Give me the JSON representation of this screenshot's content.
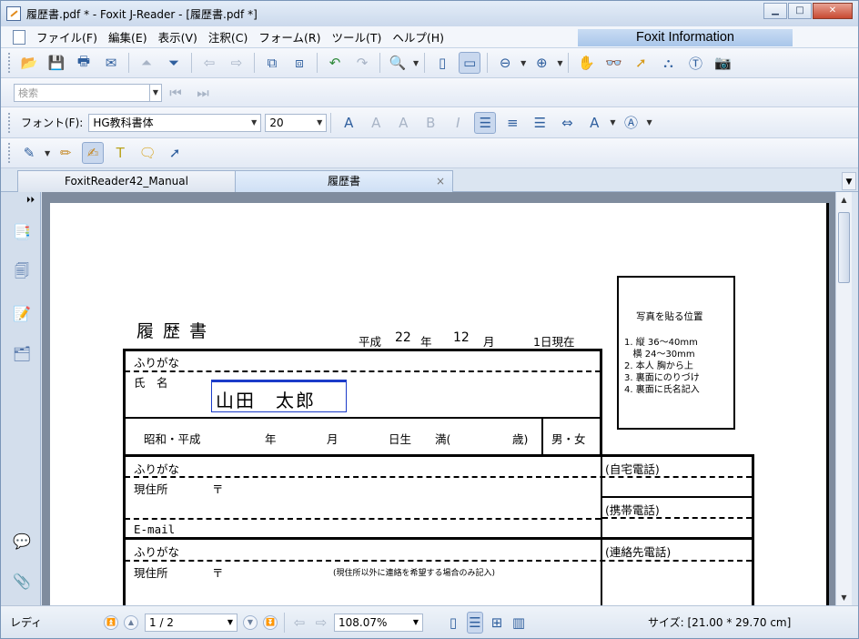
{
  "window": {
    "title": "履歴書.pdf * - Foxit J-Reader - [履歴書.pdf *]",
    "buttons": {
      "minimize": "▁",
      "maximize": "□",
      "close": "✕"
    }
  },
  "menu": {
    "items": [
      "ファイル(F)",
      "編集(E)",
      "表示(V)",
      "注釈(C)",
      "フォーム(R)",
      "ツール(T)",
      "ヘルプ(H)"
    ],
    "info": "Foxit Information"
  },
  "toolbar": {
    "search_placeholder": "検索",
    "font_label": "フォント(F):",
    "font_value": "HG教科書体",
    "size_value": "20"
  },
  "tabs": [
    {
      "label": "FoxitReader42_Manual"
    },
    {
      "label": "履歴書",
      "close": "×"
    }
  ],
  "resume": {
    "heading": "履 歴 書",
    "date_era": "平成",
    "date_year": "22",
    "date_year_unit": "年",
    "date_month": "12",
    "date_month_unit": "月",
    "date_day": "1日現在",
    "photo_title": "写真を貼る位置",
    "photo_notes": [
      "1. 縦 36～40mm",
      "   横 24～30mm",
      "2. 本人 胸から上",
      "3. 裏面にのりづけ",
      "4. 裏面に氏名記入"
    ],
    "furigana": "ふりがな",
    "name_label": "氏　名",
    "name_value": "山田　太郎",
    "birth_era": "昭和・平成",
    "birth_year": "年",
    "birth_month": "月",
    "birth_day": "日生",
    "age": "満(",
    "age_unit": "歳)",
    "gender": "男・女",
    "furigana2": "ふりがな",
    "home_phone": "(自宅電話)",
    "address_label": "現住所",
    "postal": "〒",
    "mobile_phone": "(携帯電話)",
    "email": "E-mail",
    "furigana3": "ふりがな",
    "contact_phone": "(連絡先電話)",
    "address2_label": "現住所",
    "postal2": "〒",
    "address2_note": "(現住所以外に連絡を希望する場合のみ記入)"
  },
  "status": {
    "ready": "レディ",
    "page": "1 / 2",
    "zoom": "108.07%",
    "size": "サイズ: [21.00 * 29.70 cm]"
  }
}
